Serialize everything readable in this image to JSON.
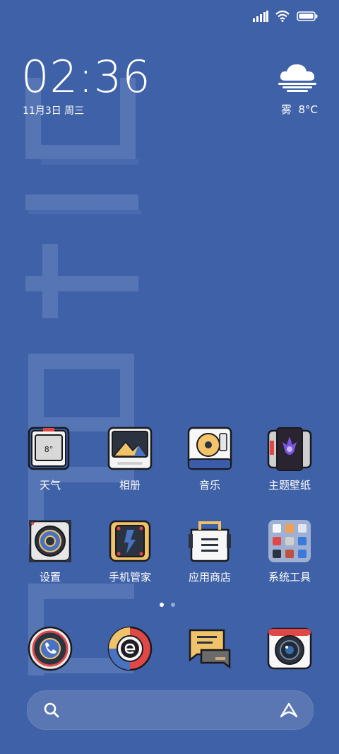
{
  "status_bar": {
    "icons": [
      "signal-icon",
      "wifi-icon",
      "battery-icon"
    ]
  },
  "clock": {
    "time": "02:36",
    "date": "11月3日 周三"
  },
  "weather": {
    "icon": "fog-cloud-icon",
    "condition": "雾",
    "temperature": "8°C",
    "tile_temp": "8°"
  },
  "apps_row1": [
    {
      "label": "天气",
      "icon": "weather-icon"
    },
    {
      "label": "相册",
      "icon": "gallery-icon"
    },
    {
      "label": "音乐",
      "icon": "music-icon"
    },
    {
      "label": "主题壁纸",
      "icon": "themes-icon"
    }
  ],
  "apps_row2": [
    {
      "label": "设置",
      "icon": "settings-icon"
    },
    {
      "label": "手机管家",
      "icon": "security-icon"
    },
    {
      "label": "应用商店",
      "icon": "app-store-icon"
    },
    {
      "label": "系统工具",
      "icon": "tools-folder-icon"
    }
  ],
  "page_indicator": {
    "pages": 2,
    "current": 1
  },
  "dock": [
    "phone-icon",
    "browser-icon",
    "messages-icon",
    "camera-icon"
  ],
  "search": {
    "icon": "search-icon",
    "assistant_icon": "assistant-icon"
  },
  "colors": {
    "wallpaper": "#3f61a7",
    "text": "#ffffff"
  }
}
